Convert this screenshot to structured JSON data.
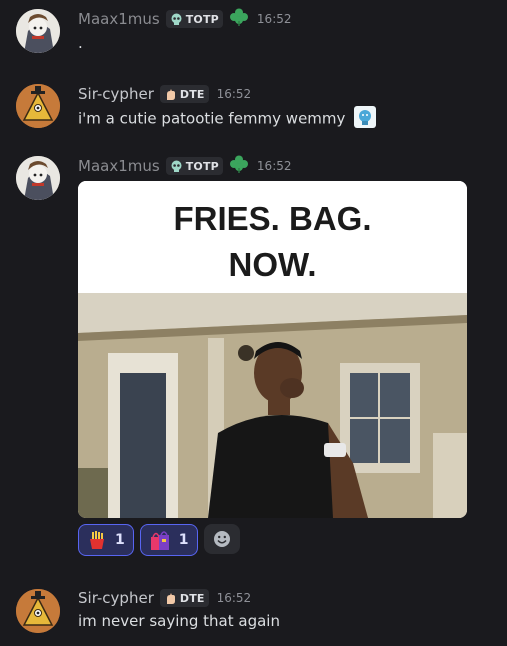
{
  "messages": [
    {
      "username": "Maax1mus",
      "tag": "TOTP",
      "time": "16:52",
      "text": "."
    },
    {
      "username": "Sir-cypher",
      "tag": "DTE",
      "time": "16:52",
      "text": "i'm a cutie patootie femmy wemmy"
    },
    {
      "username": "Maax1mus",
      "tag": "TOTP",
      "time": "16:52",
      "caption_line1": "FRIES. BAG.",
      "caption_line2": "NOW."
    },
    {
      "username": "Sir-cypher",
      "tag": "DTE",
      "time": "16:52",
      "text": "im never saying that again"
    }
  ],
  "reactions": [
    {
      "emoji": "fries-emoji",
      "count": "1"
    },
    {
      "emoji": "shopping-bags-emoji",
      "count": "1"
    }
  ],
  "icons": {
    "skull": "skull-icon",
    "role": "clover-icon",
    "hand": "pinched-hand-icon",
    "add_reaction": "smiley-icon"
  },
  "colors": {
    "background": "#1a1a1e",
    "role_green": "#3ba55d",
    "reaction_accent": "#5865f2"
  }
}
